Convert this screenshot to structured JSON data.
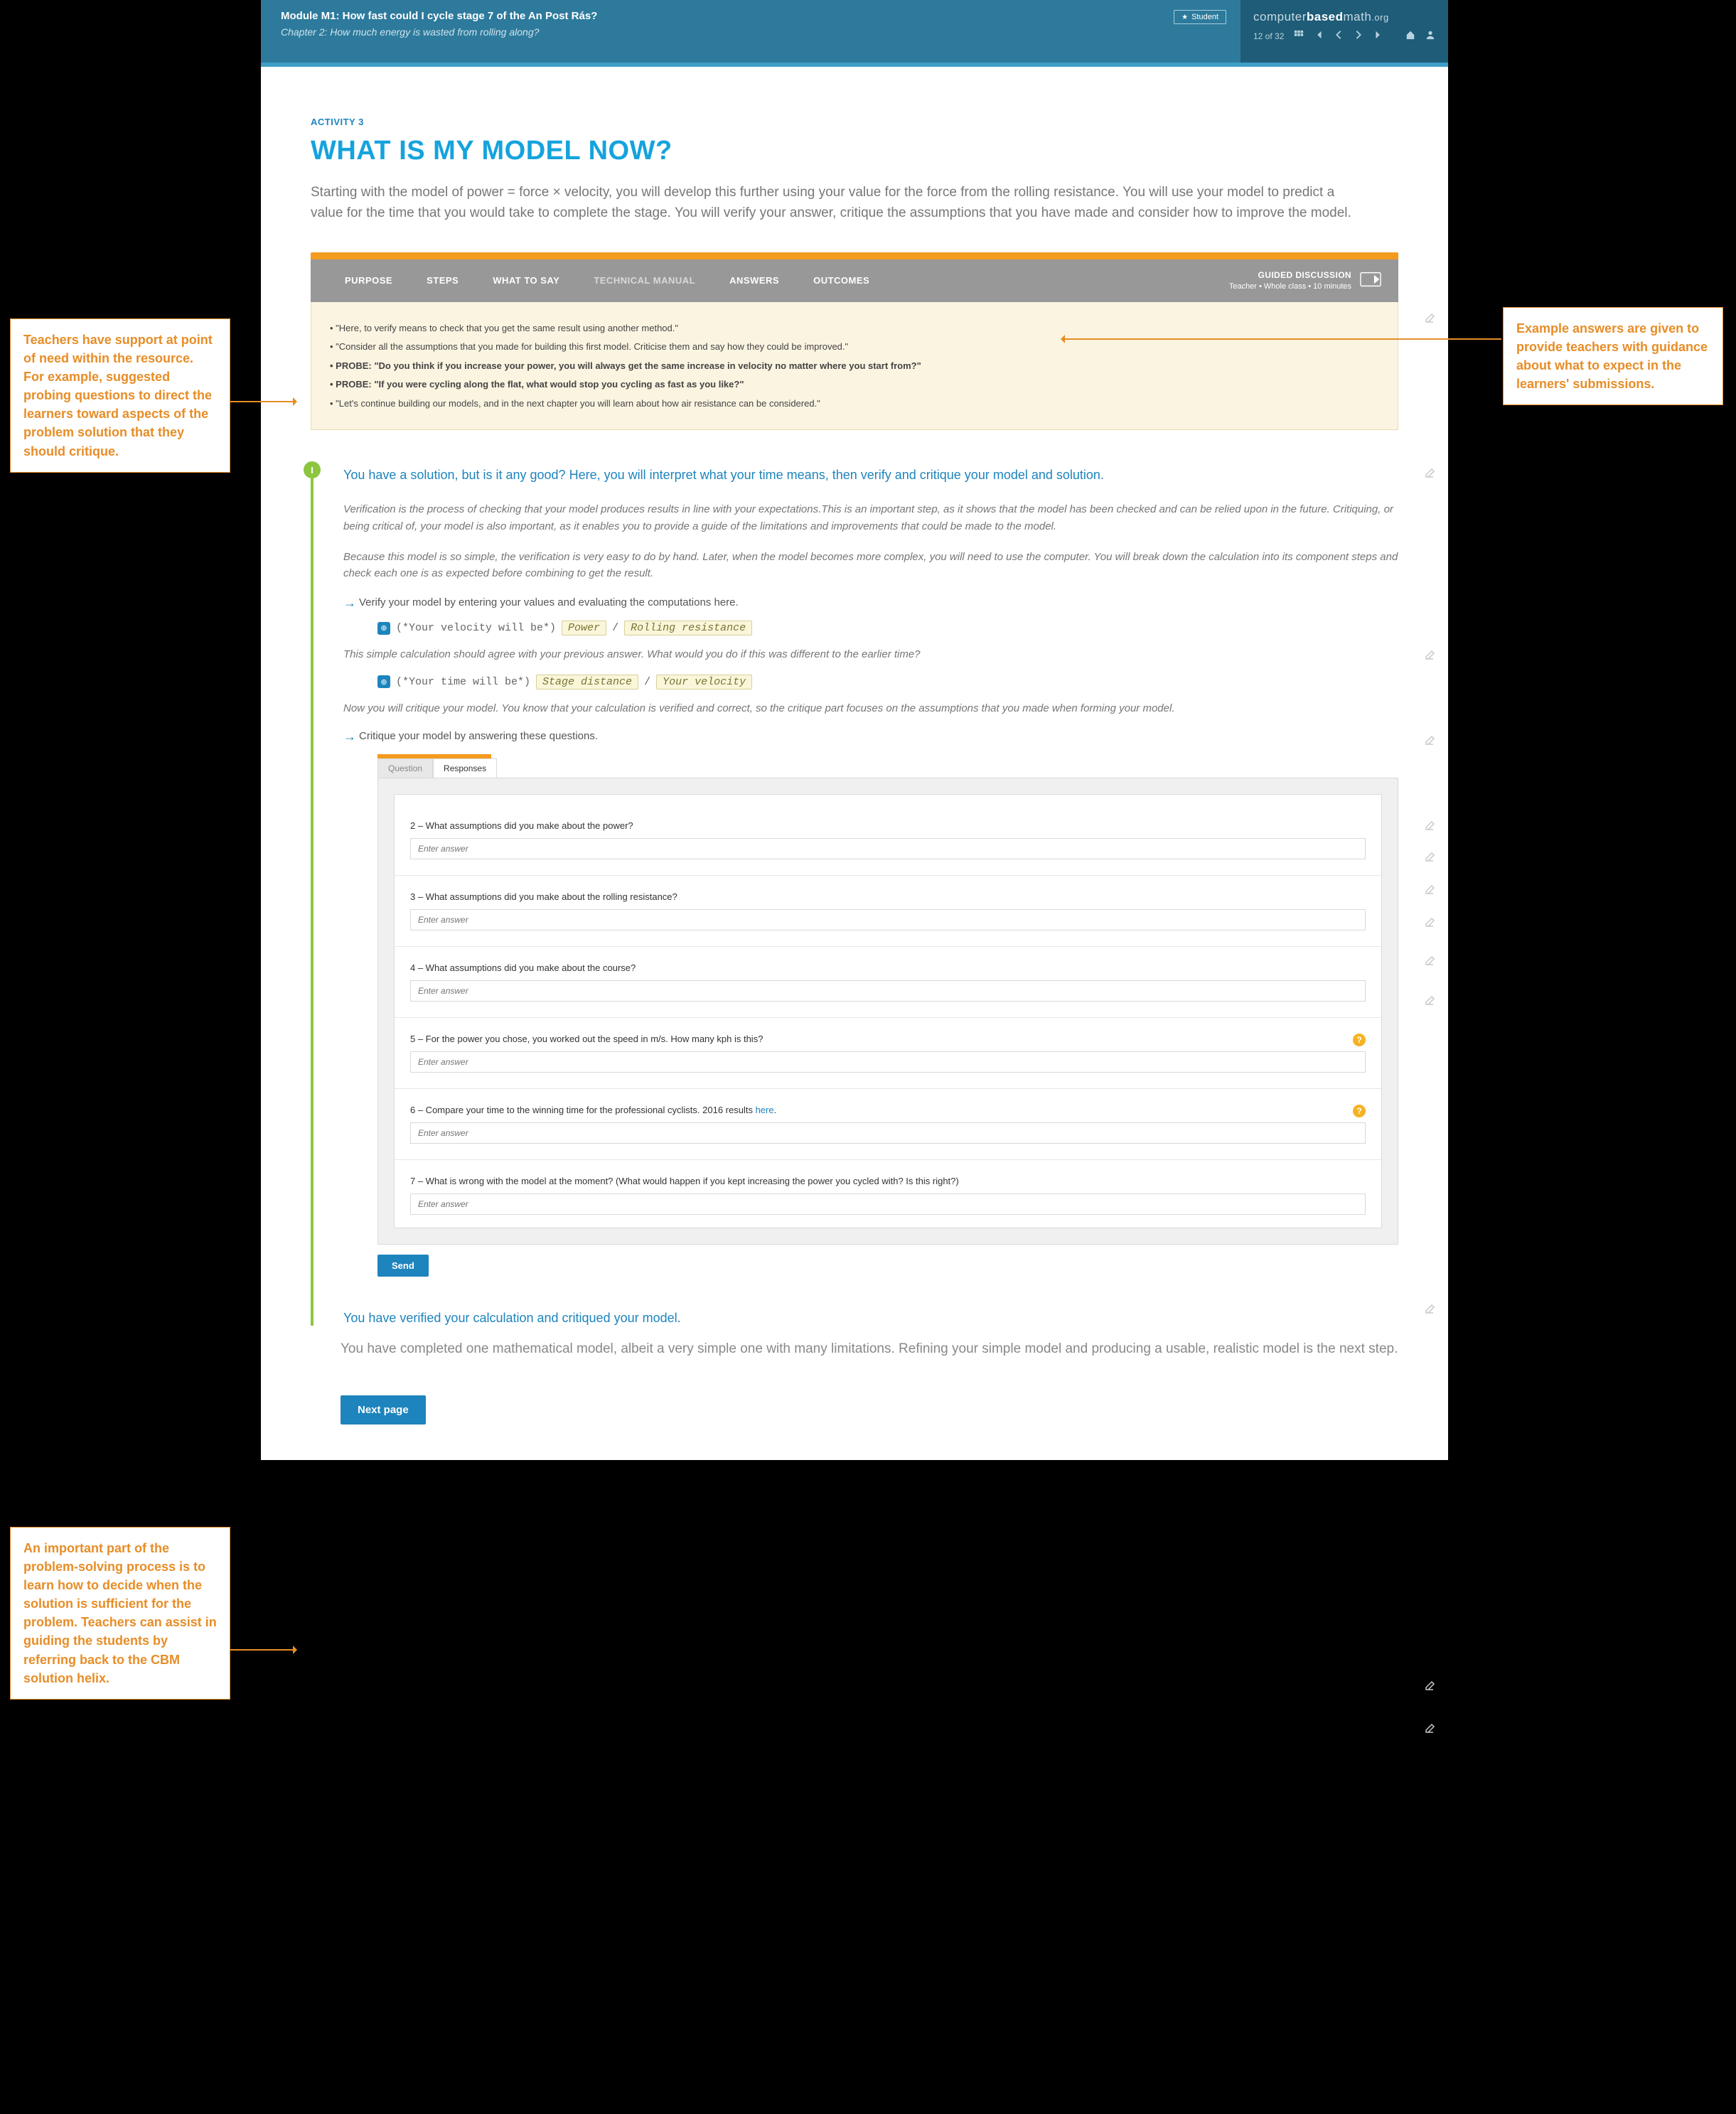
{
  "header": {
    "module": "Module M1: How fast could I cycle stage 7 of the An Post Rás?",
    "chapter": "Chapter 2: How much energy is wasted from rolling along?",
    "student_label": "Student",
    "brand1": "computer",
    "brand2": "based",
    "brand3": "math",
    "brand_suffix": ".org",
    "page_indicator": "12 of 32"
  },
  "activity": {
    "eyebrow": "ACTIVITY 3",
    "title": "WHAT IS MY MODEL NOW?",
    "intro": "Starting with the model of power = force × velocity, you will develop this further using your value for the force from the rolling resistance. You will use your model to predict a value for the time that you would take to complete the stage. You will verify your answer, critique the assumptions that you have made and consider how to improve the model."
  },
  "tabs": [
    "PURPOSE",
    "STEPS",
    "WHAT TO SAY",
    "TECHNICAL MANUAL",
    "ANSWERS",
    "OUTCOMES"
  ],
  "discussion": {
    "title": "GUIDED DISCUSSION",
    "meta": "Teacher  •  Whole class  •  10 minutes"
  },
  "say": [
    {
      "text": "\"Here, to verify means to check that you get the same result using another method.\"",
      "bold": false
    },
    {
      "text": "\"Consider all the assumptions that you made for building this first model. Criticise them and say how they could be improved.\"",
      "bold": false
    },
    {
      "text": "PROBE: \"Do you think if you increase your power, you will always get the same increase in velocity no matter where you start from?\"",
      "bold": true
    },
    {
      "text": "PROBE: \"If you were cycling along the flat, what would stop you cycling as fast as you like?\"",
      "bold": true
    },
    {
      "text": "\"Let's continue building our models, and in the next chapter you will learn about how air resistance can be considered.\"",
      "bold": false
    }
  ],
  "timeline": {
    "badge": "I",
    "lead": "You have a solution, but is it any good? Here, you will interpret what your time means, then verify and critique your model and solution.",
    "p1": "Verification is the process of checking that your model produces results in line with your expectations.This is an important step, as it shows that the model has been checked and can be relied upon in the future. Critiquing, or being critical of, your model is also important, as it enables you to provide a guide of the limitations and improvements that could be made to the model.",
    "p2": "Because this model is so simple, the verification is very easy to do by hand. Later, when the model becomes more complex, you will need to use the computer. You will break down the calculation into its component steps and check each one is as expected before combining to get the result.",
    "task1": "Verify your model by entering your values and evaluating the computations here.",
    "code1_prefix": "(*Your velocity will be*)",
    "code1_chip1": "Power",
    "code1_chip2": "Rolling resistance",
    "between1": "This simple calculation should agree with your previous answer. What would you do if this was different to the earlier time?",
    "code2_prefix": "(*Your time will be*)",
    "code2_chip1": "Stage distance",
    "code2_chip2": "Your velocity",
    "p3": "Now you will critique your model. You know that your calculation is verified and correct, so the critique part focuses on the assumptions that you made when forming your model.",
    "task2": "Critique your model by answering these questions.",
    "qtabs": {
      "a": "Question",
      "b": "Responses"
    },
    "questions": [
      {
        "n": "2",
        "q": "What assumptions did you make about the power?",
        "help": false
      },
      {
        "n": "3",
        "q": "What assumptions did you make about the rolling resistance?",
        "help": false
      },
      {
        "n": "4",
        "q": "What assumptions did you make about the course?",
        "help": false
      },
      {
        "n": "5",
        "q": "For the power you chose, you worked out the speed in m/s. How many kph is this?",
        "help": true
      },
      {
        "n": "6",
        "q": "Compare your time to the winning time for the professional cyclists. 2016 results ",
        "link": "here",
        "suffix": ".",
        "help": true
      },
      {
        "n": "7",
        "q": "What is wrong with the model at the moment? (What would happen if you kept increasing the power you cycled with? Is this right?)",
        "help": false
      }
    ],
    "placeholder": "Enter answer",
    "send": "Send",
    "verify": "You have verified your calculation and critiqued your model.",
    "closing": "You have completed one mathematical model, albeit a very simple one with many limitations. Refining your simple model and producing a usable, realistic model is the next step.",
    "next": "Next page"
  },
  "callouts": {
    "left1": "Teachers have support at point of need within the resource. For example, suggested probing questions to direct the learners toward aspects of the problem solution that they should critique.",
    "left2": "An important part of the problem-solving process is to learn how to decide when the solution is sufficient for the problem. Teachers can assist in guiding the students by referring back to the CBM solution helix.",
    "right1": "Example answers are given to provide teachers with guidance about what to expect in the learners' submissions."
  }
}
